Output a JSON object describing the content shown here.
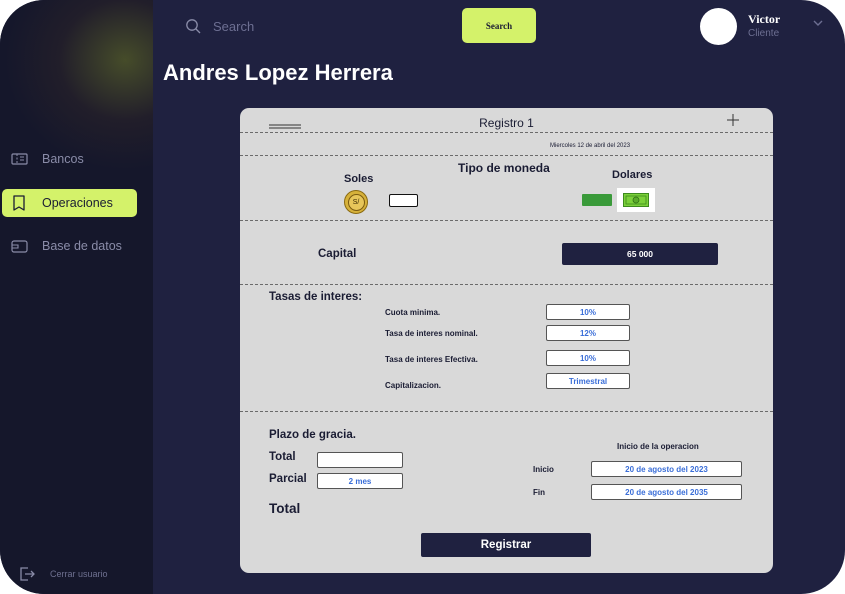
{
  "search": {
    "placeholder": "Search",
    "button_label": "Search"
  },
  "user": {
    "name": "Victor",
    "role": "Cliente"
  },
  "page_title": "Andres Lopez Herrera",
  "sidebar": {
    "items": [
      {
        "label": "Bancos",
        "icon": "ticket-icon"
      },
      {
        "label": "Operaciones",
        "icon": "receipt-icon",
        "active": true
      },
      {
        "label": "Base de datos",
        "icon": "wallet-icon"
      }
    ],
    "logout_label": "Cerrar usuario"
  },
  "card": {
    "title": "Registro 1",
    "date": "Miercoles 12 de abril del 2023",
    "currency": {
      "heading": "Tipo de moneda",
      "soles_label": "Soles",
      "soles_symbol": "S/",
      "dolares_label": "Dolares"
    },
    "capital": {
      "label": "Capital",
      "value": "65 000"
    },
    "rates": {
      "heading": "Tasas de interes:",
      "rows": [
        {
          "label": "Cuota minima.",
          "value": "10%"
        },
        {
          "label": "Tasa de interes nominal.",
          "value": "12%"
        },
        {
          "label": "Tasa de interes Efectiva.",
          "value": "10%"
        },
        {
          "label": "Capitalizacion.",
          "value": "Trimestral"
        }
      ]
    },
    "grace": {
      "heading": "Plazo de gracia.",
      "total_label": "Total",
      "total_value": "",
      "parcial_label": "Parcial",
      "parcial_value": "2 mes",
      "grand_total_label": "Total"
    },
    "operation": {
      "heading": "Inicio de la operacion",
      "inicio_label": "Inicio",
      "inicio_value": "20 de agosto del 2023",
      "fin_label": "Fin",
      "fin_value": "20 de agosto del 2035"
    },
    "submit_label": "Registrar"
  },
  "colors": {
    "background": "#1f2140",
    "sidebar": "#15172b",
    "accent": "#d4f26a",
    "card": "#d9d9d9",
    "value_text": "#3a6ed8",
    "dollar_green": "#3a9a3a"
  }
}
